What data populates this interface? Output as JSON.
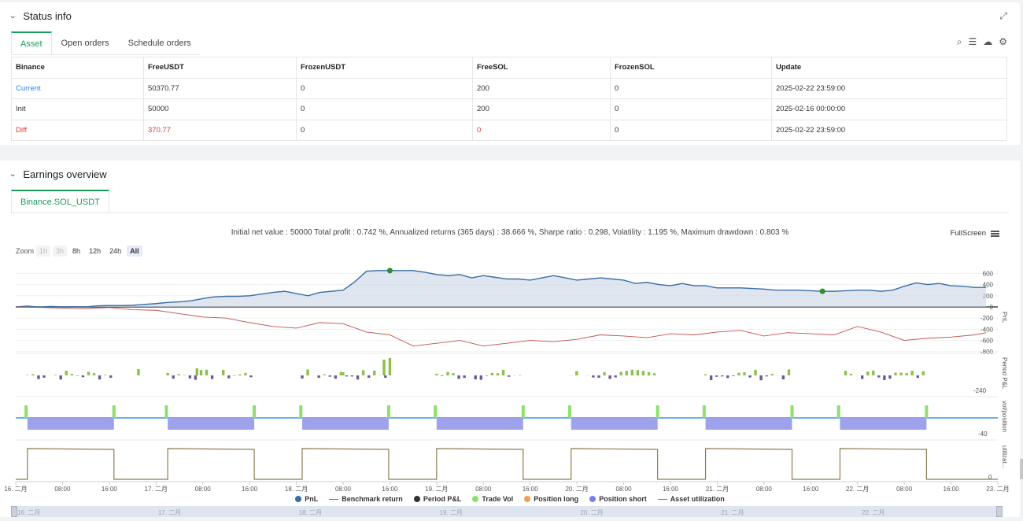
{
  "status": {
    "title": "Status info",
    "tabs": [
      "Asset",
      "Open orders",
      "Schedule orders"
    ],
    "table": {
      "headers": [
        "Binance",
        "FreeUSDT",
        "FrozenUSDT",
        "FreeSOL",
        "FrozenSOL",
        "Update"
      ],
      "rows": [
        [
          "Current",
          "50370.77",
          "0",
          "200",
          "0",
          "2025-02-22 23:59:00"
        ],
        [
          "Init",
          "50000",
          "0",
          "200",
          "0",
          "2025-02-16 00:00:00"
        ],
        [
          "Diff",
          "370.77",
          "0",
          "0",
          "0",
          "2025-02-22 23:59:00"
        ]
      ]
    }
  },
  "earnings": {
    "title": "Earnings overview",
    "tab": "Binance.SOL_USDT",
    "summary": "Initial net value : 50000 Total profit : 0.742 %, Annualized returns (365 days) : 38.666 %, Sharpe ratio : 0.298, Volatility : 1.195 %, Maximum drawdown : 0.803 %",
    "fullscreen": "FullScreen",
    "zoom_label": "Zoom",
    "zoom_buttons": [
      "1h",
      "3h",
      "8h",
      "12h",
      "24h",
      "All"
    ]
  },
  "colors": {
    "accent": "#1a9c5d",
    "pnl": "#3a6ea5",
    "benchmark": "#c0504d",
    "period_pos": "#8cc04a",
    "period_neg": "#6b5b95",
    "trade_vol": "#8ee06b",
    "position_short": "#9ea2ec",
    "utilization": "#8b7d52"
  },
  "icons": [
    "search-icon",
    "list-icon",
    "cloud-icon",
    "gear-icon",
    "expand-icon",
    "chevron-down-icon"
  ],
  "chart_data": {
    "type": "line",
    "y_axes": {
      "pnl": {
        "label": "PnL",
        "ticks": [
          "600",
          "400",
          "200",
          "0",
          "-200",
          "-400",
          "-600",
          "-800"
        ]
      },
      "period": {
        "label": "Period P&L",
        "ticks": [
          "-240"
        ]
      },
      "vol": {
        "label": "vol/position",
        "ticks": [
          "-40"
        ]
      },
      "util": {
        "label": "utilizat...",
        "ticks": [
          "0"
        ]
      }
    },
    "x_ticks": [
      "16. 二月",
      "08:00",
      "16:00",
      "17. 二月",
      "08:00",
      "16:00",
      "18. 二月",
      "08:00",
      "16:00",
      "19. 二月",
      "08:00",
      "16:00",
      "20. 二月",
      "08:00",
      "16:00",
      "21. 二月",
      "08:00",
      "16:00",
      "22. 二月",
      "08:00",
      "16:00",
      "23. 二月"
    ],
    "navigator_labels": [
      "16. 二月",
      "17. 二月",
      "18. 二月",
      "19. 二月",
      "20. 二月",
      "21. 二月",
      "22. 二月"
    ],
    "series": [
      {
        "name": "PnL",
        "x_hours": [
          0,
          2,
          4,
          6,
          8,
          10,
          12,
          14,
          16,
          18,
          20,
          22,
          24,
          26,
          28,
          30,
          32,
          34,
          36,
          38,
          40,
          42,
          44,
          46,
          48,
          50,
          52,
          54,
          56,
          58,
          60,
          62,
          64,
          66,
          68,
          70,
          72,
          74,
          76,
          78,
          80,
          82,
          84,
          86,
          88,
          90,
          92,
          94,
          96,
          98,
          100,
          102,
          104,
          106,
          108,
          110,
          112,
          114,
          116,
          118,
          120,
          122,
          124,
          126,
          128,
          130,
          132,
          134,
          136,
          138,
          140,
          142,
          144,
          146,
          148,
          150,
          152,
          154,
          156,
          158,
          160,
          162,
          164,
          166
        ],
        "values": [
          0,
          15,
          -5,
          10,
          0,
          5,
          0,
          20,
          25,
          25,
          30,
          45,
          60,
          80,
          90,
          110,
          150,
          180,
          190,
          190,
          200,
          230,
          260,
          280,
          240,
          200,
          260,
          280,
          300,
          450,
          640,
          650,
          650,
          650,
          650,
          620,
          580,
          560,
          580,
          520,
          560,
          530,
          500,
          500,
          480,
          520,
          560,
          520,
          480,
          500,
          520,
          500,
          480,
          420,
          440,
          400,
          380,
          420,
          380,
          380,
          340,
          340,
          340,
          330,
          320,
          300,
          300,
          300,
          290,
          280,
          280,
          290,
          300,
          300,
          280,
          300,
          370,
          430,
          400,
          420,
          380,
          370,
          350,
          350
        ]
      },
      {
        "name": "Benchmark return",
        "x_hours": [
          0,
          4,
          8,
          12,
          16,
          20,
          24,
          28,
          32,
          36,
          40,
          44,
          48,
          52,
          56,
          60,
          64,
          68,
          72,
          76,
          80,
          84,
          88,
          92,
          96,
          100,
          104,
          108,
          112,
          116,
          120,
          124,
          128,
          132,
          136,
          140,
          144,
          148,
          152,
          156,
          160,
          164,
          166
        ],
        "values": [
          0,
          -10,
          -20,
          -30,
          -10,
          -50,
          -60,
          -120,
          -180,
          -200,
          -280,
          -350,
          -380,
          -280,
          -300,
          -450,
          -500,
          -700,
          -650,
          -600,
          -700,
          -650,
          -600,
          -620,
          -580,
          -500,
          -520,
          -550,
          -480,
          -500,
          -450,
          -420,
          -520,
          -460,
          -480,
          -500,
          -350,
          -450,
          -600,
          -560,
          -540,
          -500,
          -460
        ]
      },
      {
        "name": "Period P&L",
        "values": []
      },
      {
        "name": "Trade Vol",
        "values": []
      },
      {
        "name": "Position long",
        "values": []
      },
      {
        "name": "Position short",
        "values": []
      },
      {
        "name": "Asset utilization",
        "values": []
      }
    ]
  }
}
